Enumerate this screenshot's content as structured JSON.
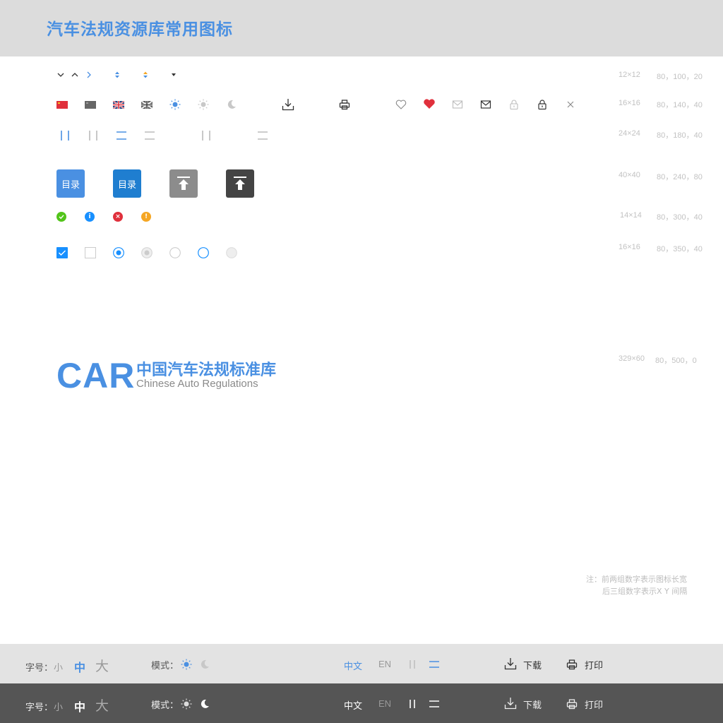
{
  "header": {
    "title": "汽车法规资源库常用图标"
  },
  "specs": {
    "row1": {
      "size": "12×12",
      "pos": "80，100，20"
    },
    "row2": {
      "size": "16×16",
      "pos": "80，140，40"
    },
    "row3": {
      "size": "24×24",
      "pos": "80，180，40"
    },
    "row4": {
      "size": "40×40",
      "pos": "80，240，80"
    },
    "row5": {
      "size": "14×14",
      "pos": "80，300，40"
    },
    "row6": {
      "size": "16×16",
      "pos": "80，350，40"
    },
    "logo": {
      "size": "329×60",
      "pos": "80，500，0"
    }
  },
  "buttons": {
    "catalog_label": "目录"
  },
  "status": {
    "info": "i",
    "error": "×",
    "warning": "!"
  },
  "logo": {
    "mark": "CAR",
    "title_cn": "中国汽车法规标准库",
    "subtitle_en": "Chinese Auto Regulations"
  },
  "note": {
    "prefix": "注：",
    "line1": "前两组数字表示图标长宽",
    "line2": "后三组数字表示X Y 间隔"
  },
  "toolbar": {
    "font_label": "字号：",
    "font_small": "小",
    "font_medium": "中",
    "font_large": "大",
    "mode_label": "模式：",
    "lang_cn": "中文",
    "lang_en": "EN",
    "download": "下载",
    "print": "打印"
  },
  "colors": {
    "accent": "#4a90e2",
    "heart": "#e0303c",
    "success": "#52c41a",
    "info": "#1890ff",
    "error": "#e0303c",
    "warning": "#f5a623",
    "dark_button": "#444444",
    "gray_button": "#8c8c8c"
  },
  "icons": [
    "chevron-down-icon",
    "chevron-up-icon",
    "chevron-right-icon",
    "sort-icon",
    "caret-down-icon",
    "flag-cn-icon",
    "flag-gray-icon",
    "flag-uk-icon",
    "sun-icon",
    "moon-icon",
    "download-icon",
    "print-icon",
    "heart-icon",
    "mail-icon",
    "lock-icon",
    "close-icon",
    "layout-columns-icon",
    "layout-rows-icon",
    "back-to-top-icon"
  ]
}
